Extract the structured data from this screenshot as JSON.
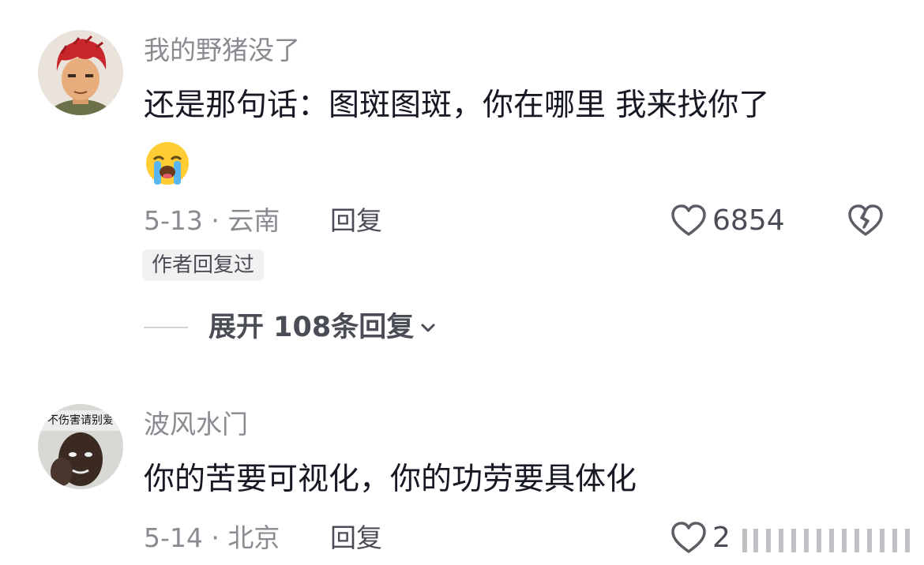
{
  "comments": [
    {
      "username": "我的野猪没了",
      "text": "还是那句话：图斑图斑，你在哪里 我来找你了",
      "emoji": "loudly-crying-face",
      "date_location": "5-13 · 云南",
      "reply_label": "回复",
      "likes": "6854",
      "badge": "作者回复过",
      "expand_label": "展开 108条回复"
    },
    {
      "username": "波风水门",
      "avatar_caption": "不伤害请别爱",
      "text": "你的苦要可视化，你的功劳要具体化",
      "date_location": "5-14 · 北京",
      "reply_label": "回复",
      "likes": "2"
    }
  ],
  "colors": {
    "text_primary": "#161823",
    "text_secondary": "#8a8b91",
    "text_action": "#4b4d56",
    "badge_bg": "#f1f1f2"
  }
}
